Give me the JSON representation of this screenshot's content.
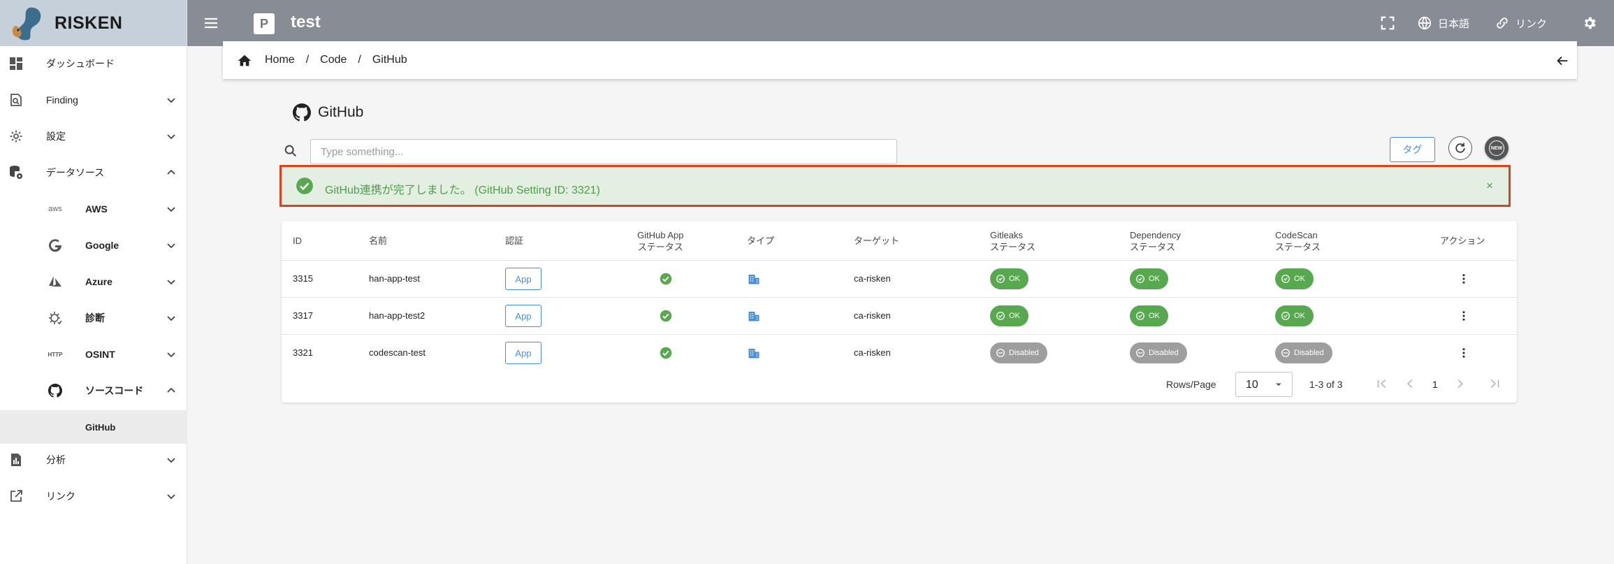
{
  "brand": {
    "name": "RISKEN"
  },
  "sidebar": {
    "items": [
      {
        "label": "ダッシュボード"
      },
      {
        "label": "Finding"
      },
      {
        "label": "設定"
      },
      {
        "label": "データソース"
      },
      {
        "label": "AWS"
      },
      {
        "label": "Google"
      },
      {
        "label": "Azure"
      },
      {
        "label": "診断"
      },
      {
        "label": "OSINT"
      },
      {
        "label": "ソースコード"
      },
      {
        "label": "GitHub"
      },
      {
        "label": "分析"
      },
      {
        "label": "リンク"
      }
    ],
    "icon_text": {
      "aws": "aws",
      "http": "HTTP"
    }
  },
  "topbar": {
    "project_badge": "P",
    "project_name": "test",
    "language_label": "日本語",
    "link_label": "リンク"
  },
  "breadcrumb": {
    "items": [
      "Home",
      "Code",
      "GitHub"
    ],
    "separator": "/"
  },
  "page": {
    "title": "GitHub"
  },
  "search": {
    "placeholder": "Type something..."
  },
  "toolbar": {
    "tag_label": "タグ",
    "new_badge": "NEW"
  },
  "alert": {
    "message": "GitHub連携が完了しました。 (GitHub Setting ID: 3321)",
    "close": "×"
  },
  "table": {
    "headers": {
      "id": "ID",
      "name": "名前",
      "auth": "認証",
      "app_status_1": "GitHub App",
      "app_status_2": "ステータス",
      "type": "タイプ",
      "target": "ターゲット",
      "gitleaks_1": "Gitleaks",
      "gitleaks_2": "ステータス",
      "dependency_1": "Dependency",
      "dependency_2": "ステータス",
      "codescan_1": "CodeScan",
      "codescan_2": "ステータス",
      "action": "アクション"
    },
    "rows": [
      {
        "id": "3315",
        "name": "han-app-test",
        "auth": "App",
        "target": "ca-risken",
        "gitleaks": "OK",
        "dependency": "OK",
        "codescan": "OK"
      },
      {
        "id": "3317",
        "name": "han-app-test2",
        "auth": "App",
        "target": "ca-risken",
        "gitleaks": "OK",
        "dependency": "OK",
        "codescan": "OK"
      },
      {
        "id": "3321",
        "name": "codescan-test",
        "auth": "App",
        "target": "ca-risken",
        "gitleaks": "Disabled",
        "dependency": "Disabled",
        "codescan": "Disabled"
      }
    ]
  },
  "pagination": {
    "rows_label": "Rows/Page",
    "rows_value": "10",
    "range": "1-3 of 3",
    "page": "1"
  },
  "colors": {
    "topbar": "#888d95",
    "brand_bg": "#c5d0db",
    "accent_blue": "#4a8fd6",
    "ok_green": "#57a84f",
    "disabled_gray": "#9e9e9e",
    "alert_bg": "#e3efe1",
    "alert_border": "#d5441c"
  }
}
